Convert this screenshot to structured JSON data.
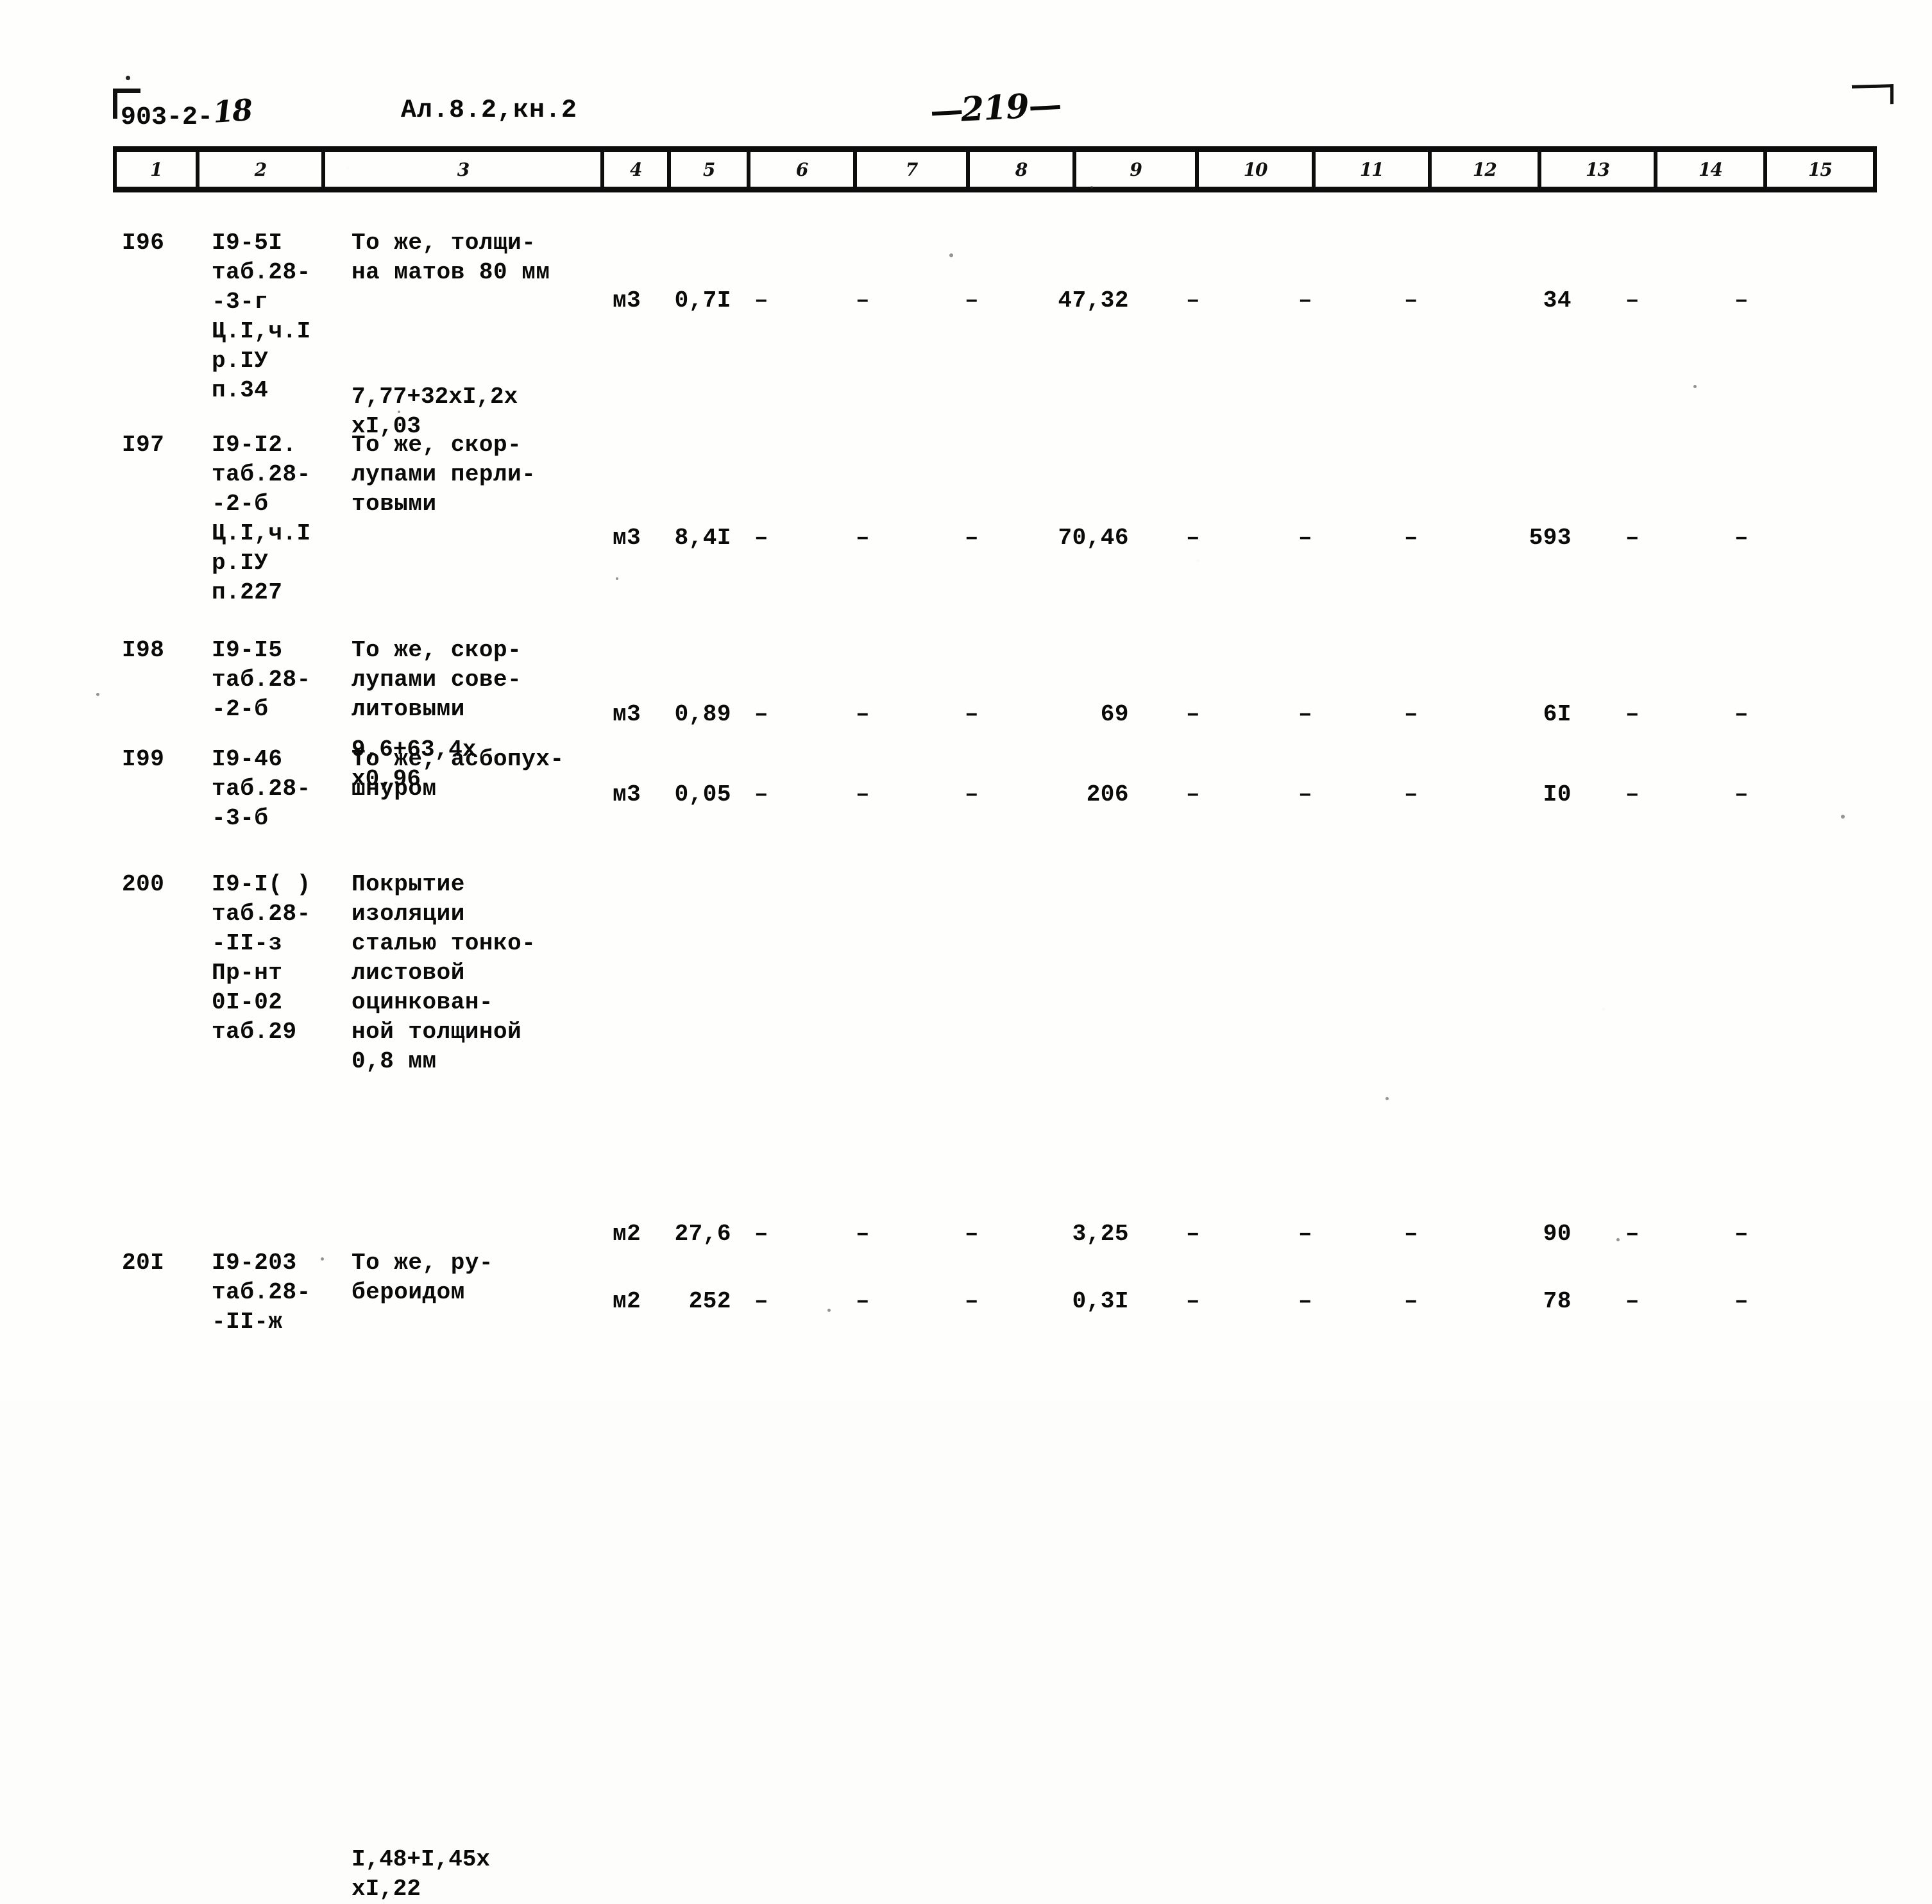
{
  "header": {
    "doc_code_printed": "903-2-",
    "doc_code_hand": "18",
    "album": "Ал.8.2,кн.2",
    "page_number": "219",
    "page_dash_left": "—",
    "page_dash_right": "—"
  },
  "table": {
    "column_numbers": [
      "1",
      "2",
      "3",
      "4",
      "5",
      "6",
      "7",
      "8",
      "9",
      "10",
      "11",
      "12",
      "13",
      "14",
      "15"
    ],
    "dash": "–",
    "rows": [
      {
        "num": "I96",
        "code_lines": [
          "I9-5I",
          "таб.28-",
          "-3-г",
          "Ц.I,ч.I",
          "р.IУ",
          "п.34"
        ],
        "desc_lines": [
          "То же, толщи-",
          "на матов 80 мм"
        ],
        "formula_lines": [
          "7,77+32хI,2х",
          "хI,03"
        ],
        "unit": "м3",
        "c5": "0,7I",
        "c6": "–",
        "c7": "–",
        "c8": "–",
        "c9": "47,32",
        "c10": "–",
        "c11": "–",
        "c12": "–",
        "c13": "34",
        "c14": "–",
        "c15": "–"
      },
      {
        "num": "I97",
        "code_lines": [
          "I9-I2.",
          "таб.28-",
          "-2-б",
          "Ц.I,ч.I",
          "р.IУ",
          "п.227"
        ],
        "desc_lines": [
          "То же, скор-",
          "лупами перли-",
          "товыми"
        ],
        "formula_lines": [
          "9,6+63,4х",
          "х0,96"
        ],
        "unit": "м3",
        "c5": "8,4I",
        "c6": "–",
        "c7": "–",
        "c8": "–",
        "c9": "70,46",
        "c10": "–",
        "c11": "–",
        "c12": "–",
        "c13": "593",
        "c14": "–",
        "c15": "–"
      },
      {
        "num": "I98",
        "code_lines": [
          "I9-I5",
          "таб.28-",
          "-2-б"
        ],
        "desc_lines": [
          "То же, скор-",
          "лупами сове-",
          "литовыми"
        ],
        "formula_lines": [],
        "unit": "м3",
        "c5": "0,89",
        "c6": "–",
        "c7": "–",
        "c8": "–",
        "c9": "69",
        "c10": "–",
        "c11": "–",
        "c12": "–",
        "c13": "6I",
        "c14": "–",
        "c15": "–"
      },
      {
        "num": "I99",
        "code_lines": [
          "I9-46",
          "таб.28-",
          "-3-б"
        ],
        "desc_lines": [
          "То же, асбопух-",
          "шнуром"
        ],
        "formula_lines": [],
        "unit": "м3",
        "c5": "0,05",
        "c6": "–",
        "c7": "–",
        "c8": "–",
        "c9": "206",
        "c10": "–",
        "c11": "–",
        "c12": "–",
        "c13": "I0",
        "c14": "–",
        "c15": "–"
      },
      {
        "num": "200",
        "code_lines": [
          "I9-I( )",
          "таб.28-",
          "-II-з",
          "Пр-нт",
          "0I-02",
          "таб.29"
        ],
        "desc_lines": [
          "Покрытие",
          "изоляции",
          "сталью тонко-",
          "листовой",
          "оцинкован-",
          "ной толщиной",
          "0,8 мм"
        ],
        "formula_lines": [
          "I,48+I,45х",
          "хI,22"
        ],
        "unit": "м2",
        "c5": "27,6",
        "c6": "–",
        "c7": "–",
        "c8": "–",
        "c9": "3,25",
        "c10": "–",
        "c11": "–",
        "c12": "–",
        "c13": "90",
        "c14": "–",
        "c15": "–"
      },
      {
        "num": "20I",
        "code_lines": [
          "I9-203",
          "таб.28-",
          "-II-ж"
        ],
        "desc_lines": [
          "То же, ру-",
          "бероидом"
        ],
        "formula_lines": [],
        "unit": "м2",
        "c5": "252",
        "c6": "–",
        "c7": "–",
        "c8": "–",
        "c9": "0,3I",
        "c10": "–",
        "c11": "–",
        "c12": "–",
        "c13": "78",
        "c14": "–",
        "c15": "–"
      }
    ]
  }
}
